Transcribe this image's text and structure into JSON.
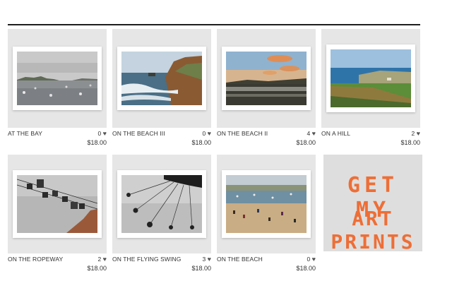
{
  "shop": {
    "header_text": "",
    "items": [
      {
        "title": "AT THE BAY",
        "likes": "0",
        "price": "$18.00"
      },
      {
        "title": "ON THE BEACH III",
        "likes": "0",
        "price": "$18.00"
      },
      {
        "title": "ON THE BEACH II",
        "likes": "4",
        "price": "$18.00"
      },
      {
        "title": "ON A HILL",
        "likes": "2",
        "price": "$18.00"
      },
      {
        "title": "ON THE ROPEWAY",
        "likes": "2",
        "price": "$18.00"
      },
      {
        "title": "ON THE FLYING SWING",
        "likes": "3",
        "price": "$18.00"
      },
      {
        "title": "ON THE BEACH",
        "likes": "0",
        "price": "$18.00"
      }
    ],
    "heart_icon": "heart-icon",
    "promo": {
      "line1": "GET MY",
      "line2": "ART PRINTS",
      "color": "#ee6e36"
    }
  }
}
